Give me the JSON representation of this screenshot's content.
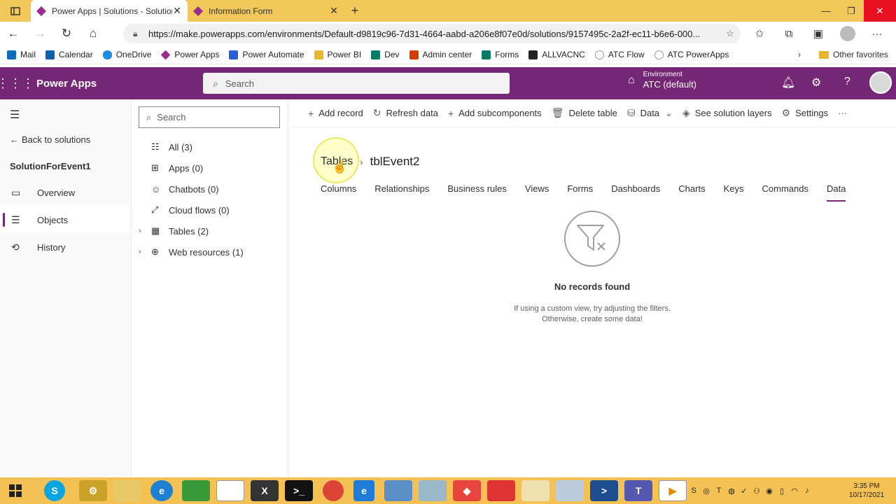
{
  "browser": {
    "tabs": [
      {
        "title": "Power Apps | Solutions - Solution",
        "active": true
      },
      {
        "title": "Information Form",
        "active": false
      }
    ],
    "url": "https://make.powerapps.com/environments/Default-d9819c96-7d31-4664-aabd-a206e8f07e0d/solutions/9157495c-2a2f-ec11-b6e6-000...",
    "bookmarks": [
      "Mail",
      "Calendar",
      "OneDrive",
      "Power Apps",
      "Power Automate",
      "Power BI",
      "Dev",
      "Admin center",
      "Forms",
      "ALLVACNC",
      "ATC Flow",
      "ATC PowerApps"
    ],
    "other_favorites": "Other favorites"
  },
  "header": {
    "app_name": "Power Apps",
    "search_placeholder": "Search",
    "env_label": "Environment",
    "env_value": "ATC (default)"
  },
  "leftnav": {
    "back": "Back to solutions",
    "solution": "SolutionForEvent1",
    "items": [
      {
        "label": "Overview",
        "icon": "overview-icon"
      },
      {
        "label": "Objects",
        "icon": "objects-icon",
        "selected": true
      },
      {
        "label": "History",
        "icon": "history-icon"
      }
    ]
  },
  "tree": {
    "search_placeholder": "Search",
    "items": [
      {
        "label": "All",
        "count": "(3)"
      },
      {
        "label": "Apps",
        "count": "(0)"
      },
      {
        "label": "Chatbots",
        "count": "(0)"
      },
      {
        "label": "Cloud flows",
        "count": "(0)"
      },
      {
        "label": "Tables",
        "count": "(2)"
      },
      {
        "label": "Web resources",
        "count": "(1)"
      }
    ]
  },
  "commands": [
    "Add record",
    "Refresh data",
    "Add subcomponents",
    "Delete table",
    "Data",
    "See solution layers",
    "Settings"
  ],
  "breadcrumb": {
    "parent": "Tables",
    "current": "tblEvent2"
  },
  "tabs": [
    "Columns",
    "Relationships",
    "Business rules",
    "Views",
    "Forms",
    "Dashboards",
    "Charts",
    "Keys",
    "Commands",
    "Data"
  ],
  "selected_tab": "Data",
  "empty": {
    "title": "No records found",
    "line1": "If using a custom view, try adjusting the filters.",
    "line2": "Otherwise, create some data!"
  },
  "taskbar": {
    "time": "3:35 PM",
    "date": "10/17/2021"
  }
}
